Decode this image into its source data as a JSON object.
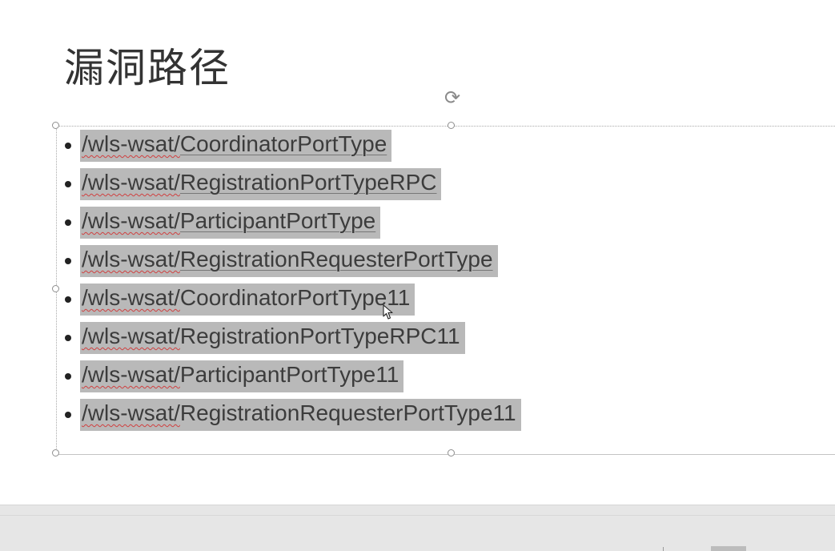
{
  "slide": {
    "title": "漏洞路径",
    "paths": [
      {
        "prefix": "/wls-wsat/",
        "name": "CoordinatorPortType",
        "underline_name": true
      },
      {
        "prefix": "/wls-wsat/",
        "name": "RegistrationPortTypeRPC",
        "underline_name": true
      },
      {
        "prefix": "/wls-wsat/",
        "name": "ParticipantPortType",
        "underline_name": true
      },
      {
        "prefix": "/wls-wsat/",
        "name": "RegistrationRequesterPortType",
        "underline_name": true
      },
      {
        "prefix": "/wls-wsat/",
        "name": "CoordinatorPortType11",
        "underline_name": false
      },
      {
        "prefix": "/wls-wsat/",
        "name": "RegistrationPortTypeRPC11",
        "underline_name": false
      },
      {
        "prefix": "/wls-wsat/",
        "name": "ParticipantPortType11",
        "underline_name": false
      },
      {
        "prefix": "/wls-wsat/",
        "name": "RegistrationRequesterPortType11",
        "underline_name": false
      }
    ],
    "rotate_icon": "rotate-handle-icon",
    "selection_color": "#b9b9b9"
  }
}
